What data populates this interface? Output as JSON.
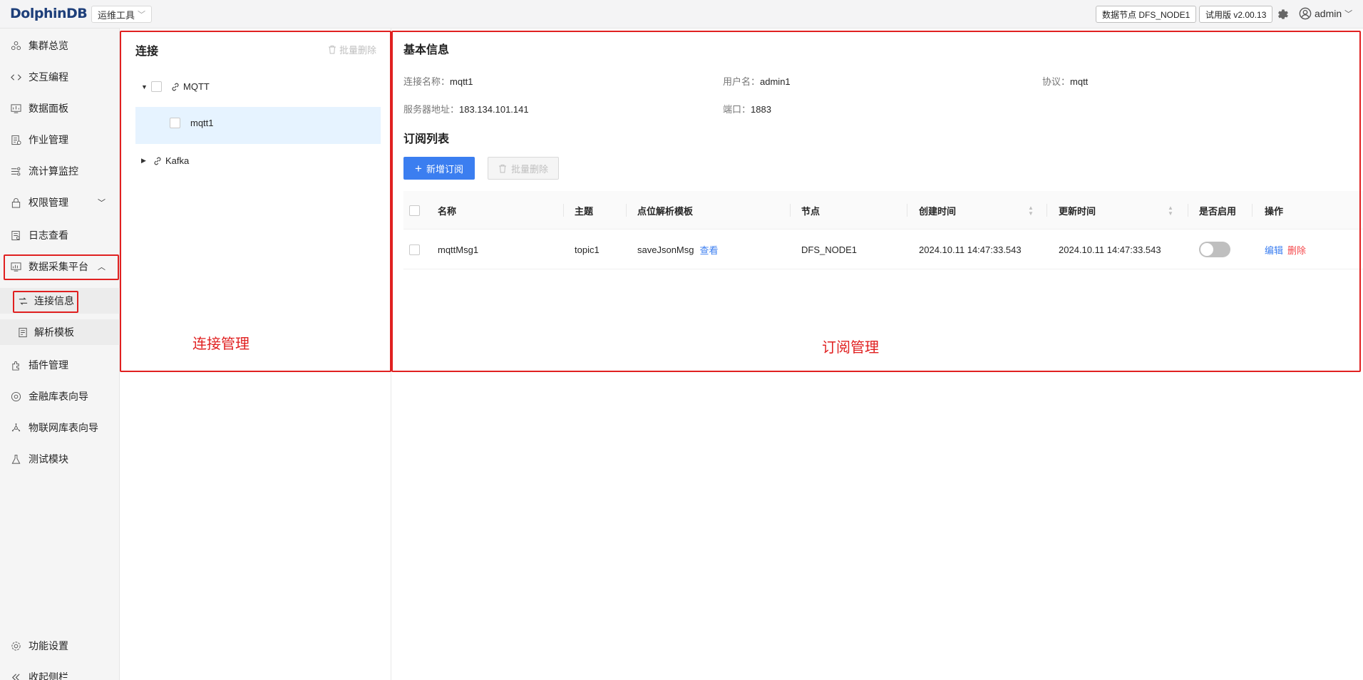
{
  "header": {
    "logo": "DolphinDB",
    "tools_select": "运维工具",
    "node_label": "数据节点 DFS_NODE1",
    "version_label": "试用版 v2.00.13",
    "user": "admin"
  },
  "sidebar": {
    "items": [
      {
        "label": "集群总览"
      },
      {
        "label": "交互编程"
      },
      {
        "label": "数据面板"
      },
      {
        "label": "作业管理"
      },
      {
        "label": "流计算监控"
      },
      {
        "label": "权限管理"
      },
      {
        "label": "日志查看"
      },
      {
        "label": "数据采集平台"
      },
      {
        "label": "插件管理"
      },
      {
        "label": "金融库表向导"
      },
      {
        "label": "物联网库表向导"
      },
      {
        "label": "测试模块"
      }
    ],
    "sub_items": [
      {
        "label": "连接信息"
      },
      {
        "label": "解析模板"
      }
    ],
    "footer": {
      "settings": "功能设置",
      "collapse": "收起侧栏"
    }
  },
  "left_panel": {
    "title": "连接",
    "batch_delete": "批量删除",
    "tree": {
      "mqtt": "MQTT",
      "mqtt_child": "mqtt1",
      "kafka": "Kafka"
    },
    "annotation": "连接管理"
  },
  "right_panel": {
    "basic_title": "基本信息",
    "fields": {
      "conn_name_label": "连接名称：",
      "conn_name": "mqtt1",
      "user_label": "用户名：",
      "user": "admin1",
      "protocol_label": "协议：",
      "protocol": "mqtt",
      "server_label": "服务器地址：",
      "server": "183.134.101.141",
      "port_label": "端口：",
      "port": "1883"
    },
    "sub_title": "订阅列表",
    "add_button": "新增订阅",
    "batch_delete": "批量删除",
    "table": {
      "headers": [
        "名称",
        "主题",
        "点位解析模板",
        "节点",
        "创建时间",
        "更新时间",
        "是否启用",
        "操作"
      ],
      "rows": [
        {
          "name": "mqttMsg1",
          "topic": "topic1",
          "template": "saveJsonMsg",
          "view": "查看",
          "node": "DFS_NODE1",
          "created": "2024.10.11 14:47:33.543",
          "updated": "2024.10.11 14:47:33.543",
          "enabled": false,
          "edit": "编辑",
          "delete": "删除"
        }
      ]
    },
    "annotation": "订阅管理"
  }
}
